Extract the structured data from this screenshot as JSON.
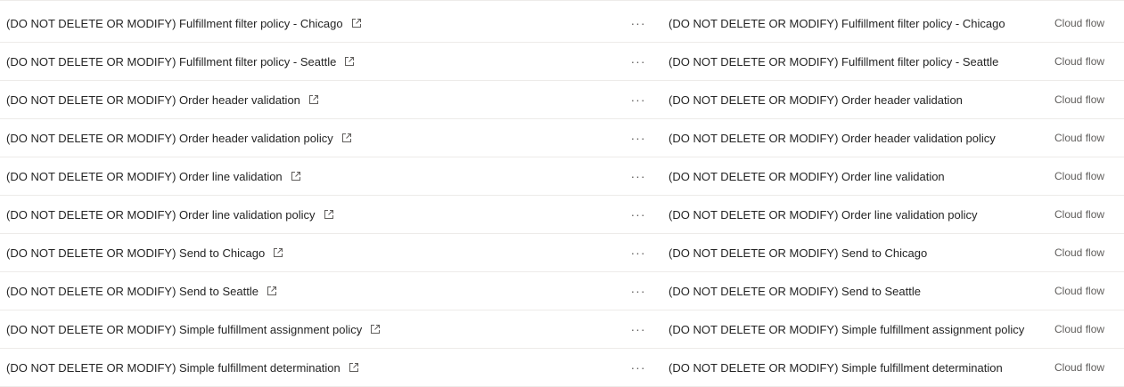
{
  "table": {
    "rows": [
      {
        "name": "(DO NOT DELETE OR MODIFY) Fulfillment filter policy - Chicago",
        "display_name": "(DO NOT DELETE OR MODIFY) Fulfillment filter policy - Chicago",
        "type": "Cloud flow",
        "more_label": "···",
        "icon": "open-in-new-window-icon"
      },
      {
        "name": "(DO NOT DELETE OR MODIFY) Fulfillment filter policy - Seattle",
        "display_name": "(DO NOT DELETE OR MODIFY) Fulfillment filter policy - Seattle",
        "type": "Cloud flow",
        "more_label": "···",
        "icon": "open-in-new-window-icon"
      },
      {
        "name": "(DO NOT DELETE OR MODIFY) Order header validation",
        "display_name": "(DO NOT DELETE OR MODIFY) Order header validation",
        "type": "Cloud flow",
        "more_label": "···",
        "icon": "open-in-new-window-icon"
      },
      {
        "name": "(DO NOT DELETE OR MODIFY) Order header validation policy",
        "display_name": "(DO NOT DELETE OR MODIFY) Order header validation policy",
        "type": "Cloud flow",
        "more_label": "···",
        "icon": "open-in-new-window-icon"
      },
      {
        "name": "(DO NOT DELETE OR MODIFY) Order line validation",
        "display_name": "(DO NOT DELETE OR MODIFY) Order line validation",
        "type": "Cloud flow",
        "more_label": "···",
        "icon": "open-in-new-window-icon"
      },
      {
        "name": "(DO NOT DELETE OR MODIFY) Order line validation policy",
        "display_name": "(DO NOT DELETE OR MODIFY) Order line validation policy",
        "type": "Cloud flow",
        "more_label": "···",
        "icon": "open-in-new-window-icon"
      },
      {
        "name": "(DO NOT DELETE OR MODIFY) Send to Chicago",
        "display_name": "(DO NOT DELETE OR MODIFY) Send to Chicago",
        "type": "Cloud flow",
        "more_label": "···",
        "icon": "open-in-new-window-icon"
      },
      {
        "name": "(DO NOT DELETE OR MODIFY) Send to Seattle",
        "display_name": "(DO NOT DELETE OR MODIFY) Send to Seattle",
        "type": "Cloud flow",
        "more_label": "···",
        "icon": "open-in-new-window-icon"
      },
      {
        "name": "(DO NOT DELETE OR MODIFY) Simple fulfillment assignment policy",
        "display_name": "(DO NOT DELETE OR MODIFY) Simple fulfillment assignment policy",
        "type": "Cloud flow",
        "more_label": "···",
        "icon": "open-in-new-window-icon"
      },
      {
        "name": "(DO NOT DELETE OR MODIFY) Simple fulfillment determination",
        "display_name": "(DO NOT DELETE OR MODIFY) Simple fulfillment determination",
        "type": "Cloud flow",
        "more_label": "···",
        "icon": "open-in-new-window-icon"
      }
    ]
  },
  "colors": {
    "text": "#242424",
    "secondary_text": "#605e5c",
    "divider": "#edebe9"
  }
}
